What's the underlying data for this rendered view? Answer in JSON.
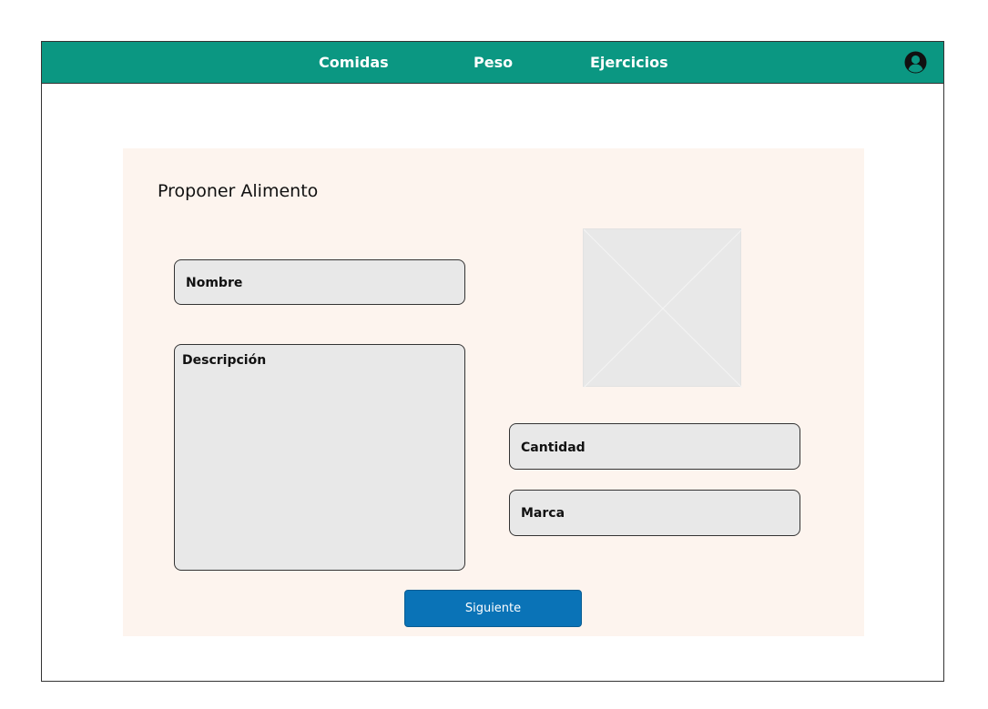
{
  "nav": {
    "links": [
      "Comidas",
      "Peso",
      "Ejercicios"
    ],
    "profile_icon": "user-circle-icon"
  },
  "form": {
    "title": "Proponer Alimento",
    "fields": {
      "nombre": "Nombre",
      "descripcion": "Descripción",
      "cantidad": "Cantidad",
      "marca": "Marca"
    },
    "image_placeholder_icon": "image-placeholder-icon",
    "next_button": "Siguiente"
  },
  "colors": {
    "navbar": "#0b9782",
    "panel": "#fdf4ee",
    "field": "#e8e8e8",
    "button": "#0a73b7"
  }
}
